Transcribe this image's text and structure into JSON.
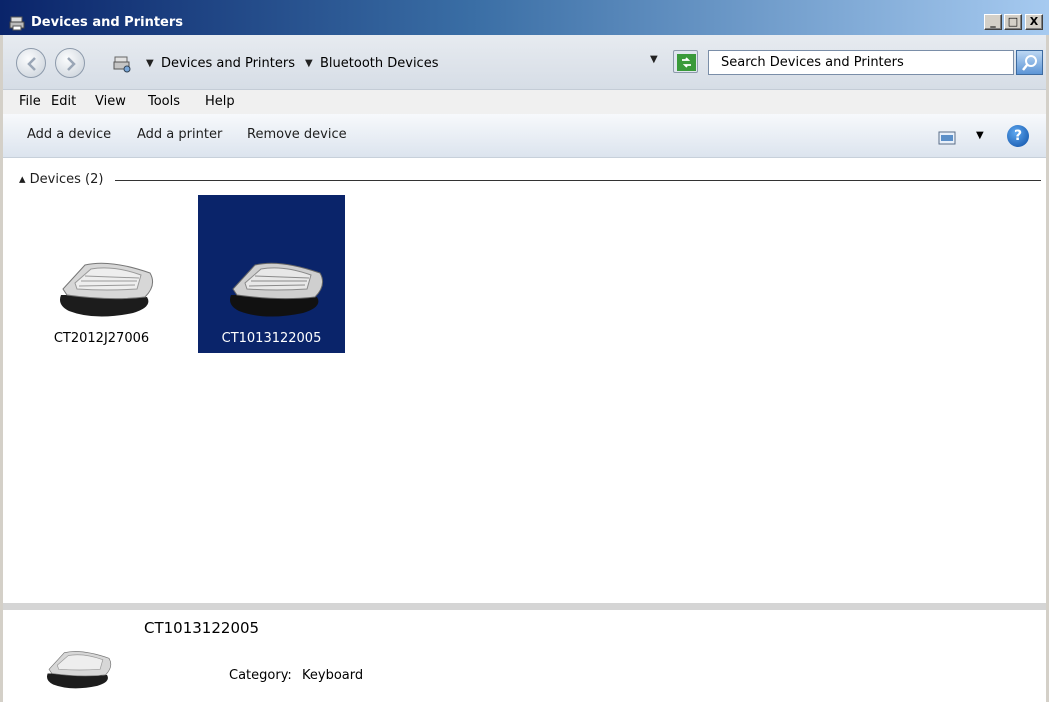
{
  "window": {
    "title": "Devices and Printers",
    "minimize_glyph": "_",
    "maximize_glyph": "□",
    "close_glyph": "X"
  },
  "address_bar": {
    "breadcrumbs": [
      "Devices and Printers",
      "Bluetooth Devices"
    ],
    "search_placeholder": "Search Devices and Printers"
  },
  "menu": [
    "File",
    "Edit",
    "View",
    "Tools",
    "Help"
  ],
  "commands": [
    "Add a device",
    "Add a printer",
    "Remove device"
  ],
  "help_glyph": "?",
  "content": {
    "group_header": "Devices (2)",
    "devices": [
      {
        "name": "CT2012J27006",
        "selected": false
      },
      {
        "name": "CT1013122005",
        "selected": true
      }
    ]
  },
  "details": {
    "device_name": "CT1013122005",
    "category_label": "Category:",
    "category_value": "Keyboard"
  },
  "colors": {
    "selection": "#0a246a",
    "titlebar_start": "#0a246a",
    "titlebar_end": "#a6caf0"
  },
  "icons": [
    "devices-printers-icon",
    "back-icon",
    "forward-icon",
    "refresh-icon",
    "search-icon",
    "view-icon",
    "help-icon",
    "keyboard-icon"
  ]
}
